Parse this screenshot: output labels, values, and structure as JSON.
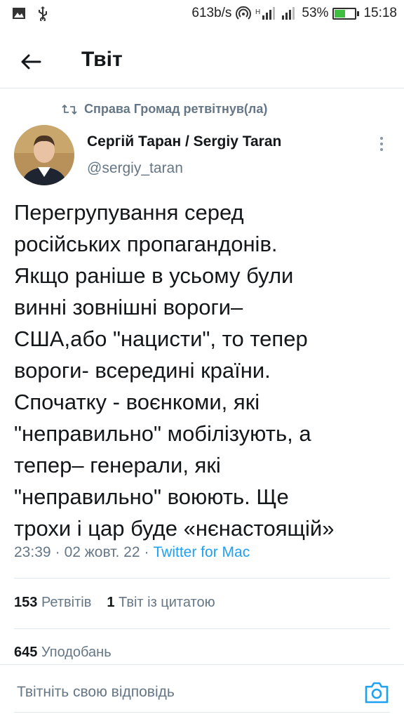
{
  "status_bar": {
    "speed": "613b/s",
    "battery_percent": "53%",
    "battery_level": 0.53,
    "time": "15:18",
    "icons": [
      "image-icon",
      "usb-icon",
      "hotspot-icon",
      "signal-icon",
      "signal-icon",
      "battery-icon"
    ]
  },
  "header": {
    "title": "Твіт"
  },
  "retweet": {
    "text": "Справа Громад ретвітнув(ла)"
  },
  "author": {
    "name": "Сергій Таран / Sergiy Taran",
    "handle": "@sergiy_taran"
  },
  "tweet": {
    "text": "Перегрупування серед\nросійських пропагандонів.\nЯкщо раніше в усьому були\nвинні зовнішні вороги–\nСША,або \"нацисти\", то тепер\nвороги- всередині країни.\nСпочатку - воєнкоми, які\n\"неправильно\" мобілізують, а\nтепер– генерали, які\n\"неправильно\" воюють. Ще\nтрохи і цар буде «нєнастоящій»"
  },
  "meta": {
    "time": "23:39",
    "separator": "·",
    "date": "02 жовт. 22",
    "separator2": "·",
    "source": "Twitter for Mac"
  },
  "stats": {
    "retweets_count": "153",
    "retweets_label": "Ретвітів",
    "quotes_count": "1",
    "quotes_label": "Твіт із цитатою",
    "likes_count": "645",
    "likes_label": "Уподобань"
  },
  "reply": {
    "placeholder": "Твітніть свою відповідь"
  },
  "colors": {
    "accent": "#1da1f2",
    "secondary_text": "#657786",
    "battery": "#3fbf3f"
  }
}
